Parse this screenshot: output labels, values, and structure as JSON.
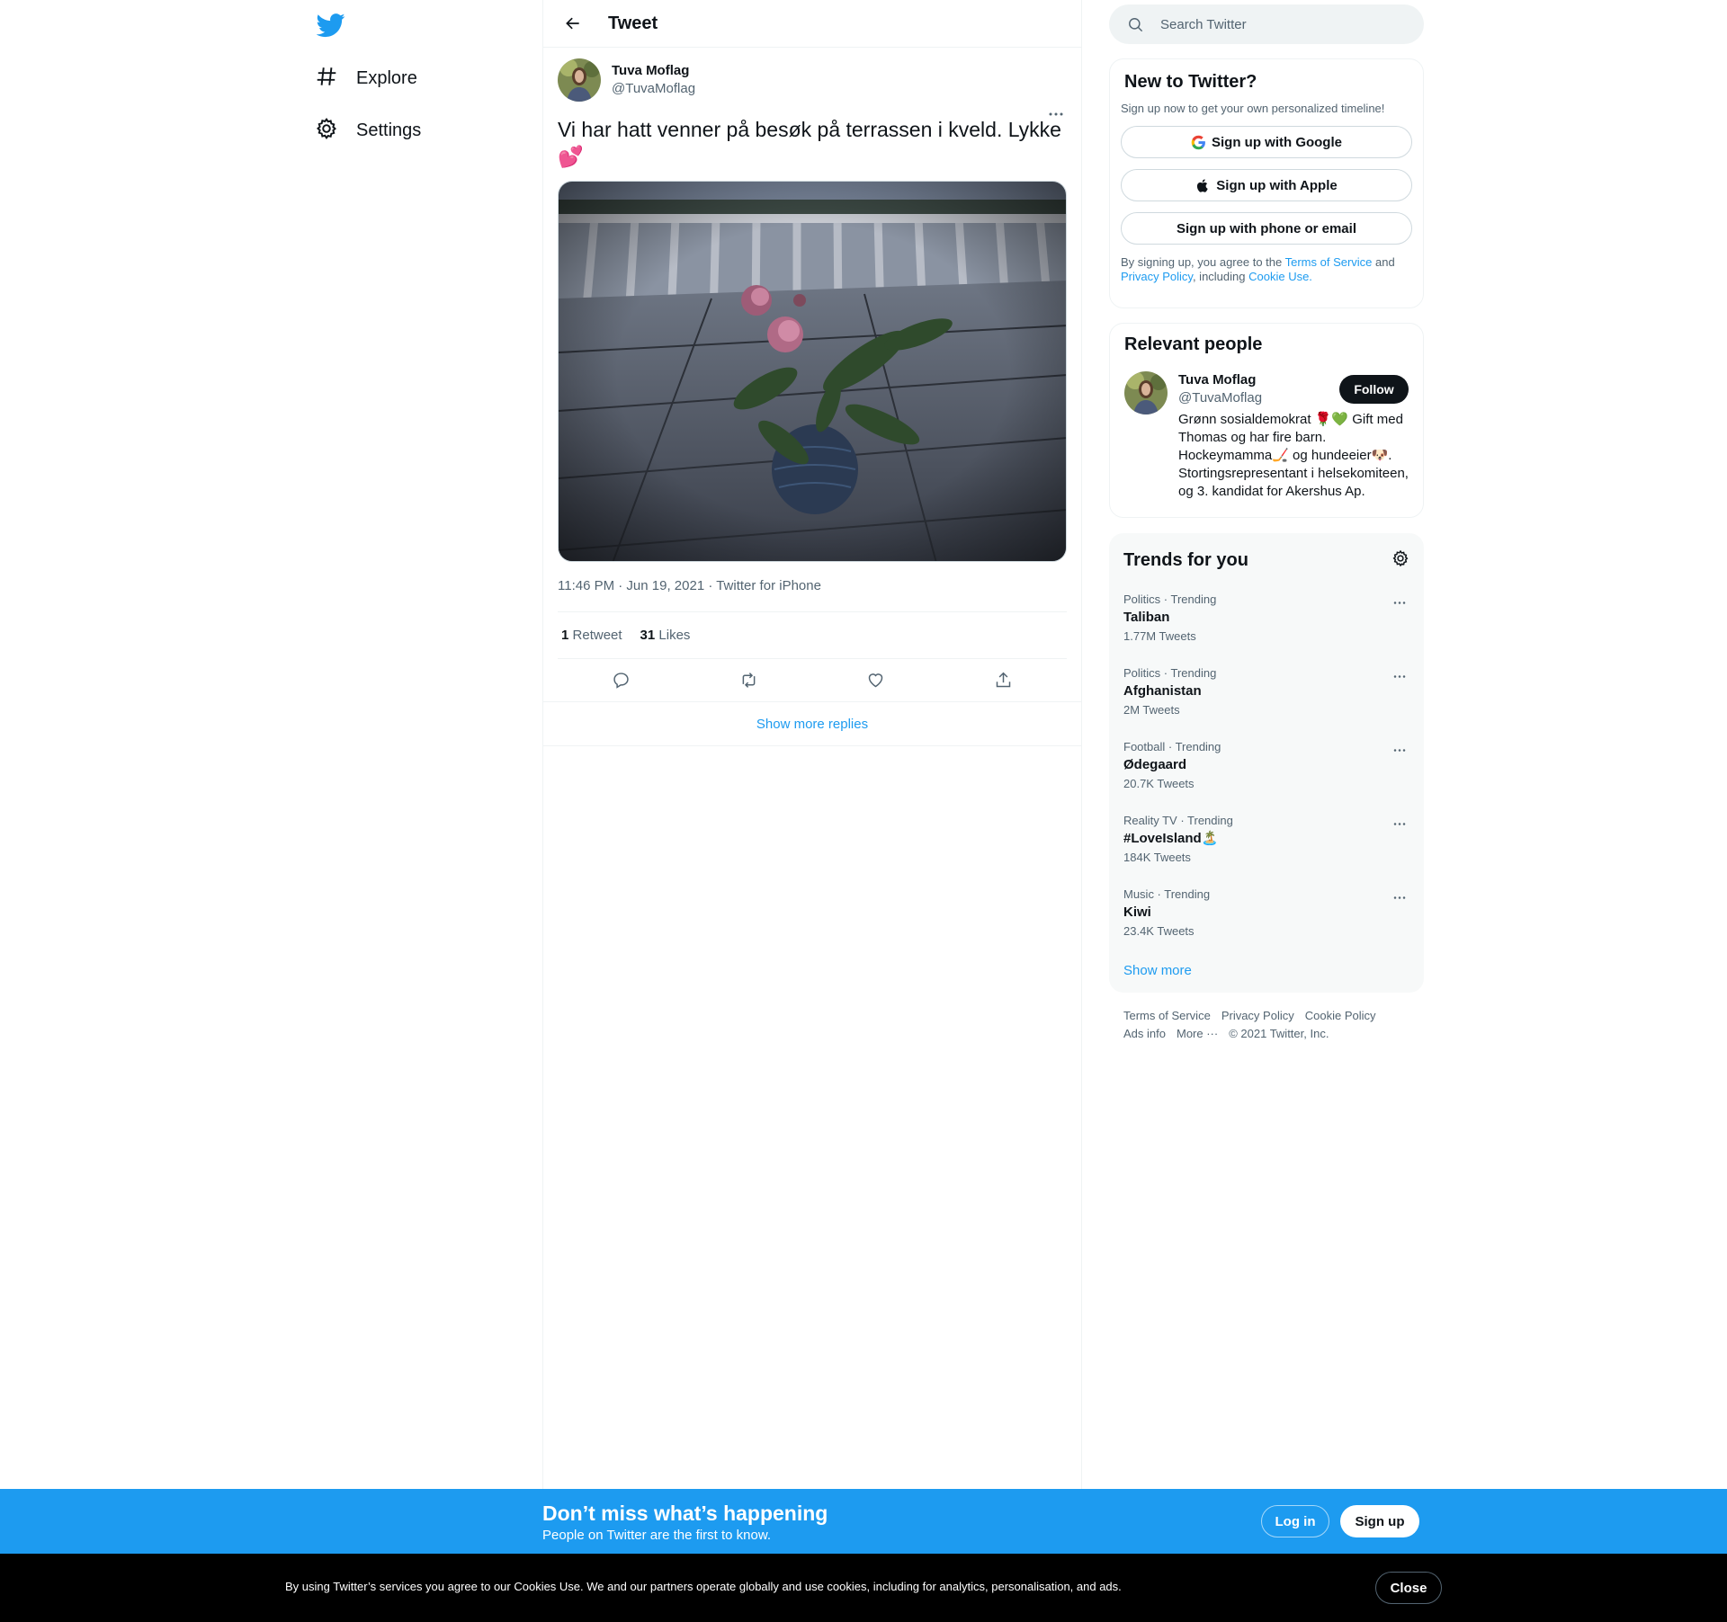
{
  "nav": {
    "logo": "twitter-bird-icon",
    "items": [
      {
        "label": "Explore",
        "icon": "hashtag-icon"
      },
      {
        "label": "Settings",
        "icon": "gear-icon"
      }
    ]
  },
  "header": {
    "title": "Tweet"
  },
  "tweet": {
    "author_name": "Tuva Moflag",
    "author_handle": "@TuvaMoflag",
    "text": "Vi har hatt venner på besøk på terrassen i kveld. Lykke 💕",
    "meta": "11:46 PM · Jun 19, 2021 · Twitter for iPhone",
    "retweets_count": "1",
    "retweets_label": "Retweet",
    "likes_count": "31",
    "likes_label": "Likes",
    "show_more_replies": "Show more replies"
  },
  "search": {
    "placeholder": "Search Twitter"
  },
  "new_to_twitter": {
    "title": "New to Twitter?",
    "subtitle": "Sign up now to get your own personalized timeline!",
    "google": "Sign up with Google",
    "apple": "Sign up with Apple",
    "phone": "Sign up with phone or email",
    "legal_1": "By signing up, you agree to the ",
    "terms": "Terms of Service",
    "legal_2": " and ",
    "privacy": "Privacy Policy",
    "legal_3": ", including ",
    "cookie": "Cookie Use."
  },
  "relevant": {
    "title": "Relevant people",
    "name": "Tuva Moflag",
    "handle": "@TuvaMoflag",
    "bio": "Grønn sosialdemokrat 🌹💚 Gift med Thomas og har fire barn. Hockeymamma🏒 og hundeeier🐶. Stortingsrepresentant i helsekomiteen, og 3. kandidat for Akershus Ap.",
    "follow": "Follow"
  },
  "trends": {
    "title": "Trends for you",
    "items": [
      {
        "category": "Politics · Trending",
        "name": "Taliban",
        "count": "1.77M Tweets"
      },
      {
        "category": "Politics · Trending",
        "name": "Afghanistan",
        "count": "2M Tweets"
      },
      {
        "category": "Football · Trending",
        "name": "Ødegaard",
        "count": "20.7K Tweets"
      },
      {
        "category": "Reality TV · Trending",
        "name": "#LoveIsland🏝️",
        "count": "184K Tweets"
      },
      {
        "category": "Music · Trending",
        "name": "Kiwi",
        "count": "23.4K Tweets"
      }
    ],
    "show_more": "Show more"
  },
  "footer": {
    "terms": "Terms of Service",
    "privacy": "Privacy Policy",
    "cookie": "Cookie Policy",
    "ads": "Ads info",
    "more": "More ···",
    "copyright": "© 2021 Twitter, Inc."
  },
  "signup_bar": {
    "title": "Don’t miss what’s happening",
    "subtitle": "People on Twitter are the first to know.",
    "login": "Log in",
    "signup": "Sign up"
  },
  "cookie_bar": {
    "text": "By using Twitter’s services you agree to our Cookies Use. We and our partners operate globally and use cookies, including for analytics, personalisation, and ads.",
    "close": "Close"
  },
  "colors": {
    "accent": "#1d9bf0",
    "text": "#0f1419",
    "secondary": "#536471"
  }
}
